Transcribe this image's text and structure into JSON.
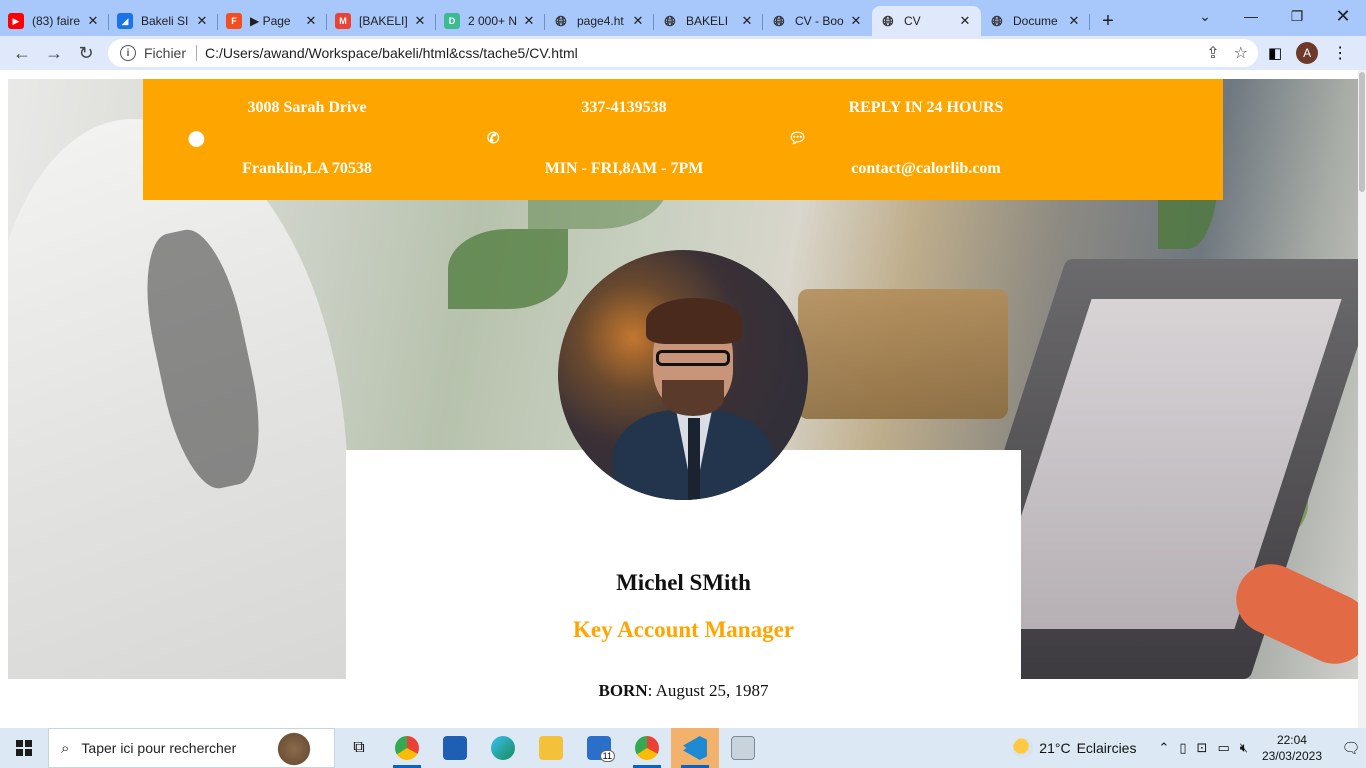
{
  "browser": {
    "tabs": [
      {
        "title": "(83) faire",
        "favicon": "youtube-icon",
        "color": "#ff0000"
      },
      {
        "title": "Bakeli SI",
        "favicon": "bakeli-icon",
        "color": "#1a73e8"
      },
      {
        "title": "▶ Page",
        "favicon": "figma-icon",
        "color": "#f24e1e"
      },
      {
        "title": "[BAKELI]",
        "favicon": "gmail-icon",
        "color": "#ea4335"
      },
      {
        "title": "2 000+ N",
        "favicon": "d-icon",
        "color": "#3cba92"
      },
      {
        "title": "page4.ht",
        "favicon": "globe-icon",
        "color": "#5f6368"
      },
      {
        "title": "BAKELI",
        "favicon": "globe-icon",
        "color": "#5f6368"
      },
      {
        "title": "CV - Boo",
        "favicon": "globe-icon",
        "color": "#5f6368"
      },
      {
        "title": "CV",
        "favicon": "globe-icon",
        "color": "#5f6368",
        "active": true
      },
      {
        "title": "Docume",
        "favicon": "globe-icon",
        "color": "#5f6368"
      }
    ],
    "address": {
      "scheme_label": "Fichier",
      "url": "C:/Users/awand/Workspace/bakeli/html&css/tache5/CV.html"
    },
    "profile_initial": "A"
  },
  "page": {
    "contact": {
      "address_line1": "3008 Sarah Drive",
      "address_line2": "Franklin,LA 70538",
      "phone_line1": "337-4139538",
      "phone_line2": "MIN - FRI,8AM - 7PM",
      "reply_line1": "REPLY IN 24 HOURS",
      "reply_line2": "contact@calorlib.com"
    },
    "profile": {
      "name": "Michel SMith",
      "role": "Key Account Manager",
      "born_label": "BORN",
      "born_value": ": August 25, 1987"
    },
    "accent_color": "#ffa500"
  },
  "taskbar": {
    "search_placeholder": "Taper ici pour rechercher",
    "weather": {
      "temp": "21°C",
      "condition": "Eclaircies"
    },
    "time": "22:04",
    "date": "23/03/2023",
    "mail_badge": "11"
  }
}
